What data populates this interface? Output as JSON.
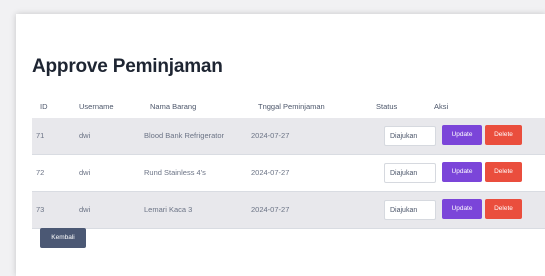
{
  "page": {
    "title": "Approve Peminjaman"
  },
  "table": {
    "headers": {
      "id": "ID",
      "username": "Username",
      "nama_barang": "Nama Barang",
      "tanggal": "Tnggal Peminjaman",
      "status": "Status",
      "aksi": "Aksi"
    },
    "rows": [
      {
        "id": "71",
        "username": "dwi",
        "nama_barang": "Blood Bank Refrigerator",
        "tanggal": "2024-07-27",
        "status": "Diajukan",
        "update": "Update",
        "delete": "Delete"
      },
      {
        "id": "72",
        "username": "dwi",
        "nama_barang": "Rund Stainless 4's",
        "tanggal": "2024-07-27",
        "status": "Diajukan",
        "update": "Update",
        "delete": "Delete"
      },
      {
        "id": "73",
        "username": "dwi",
        "nama_barang": "Lemari Kaca 3",
        "tanggal": "2024-07-27",
        "status": "Diajukan",
        "update": "Update",
        "delete": "Delete"
      }
    ]
  },
  "actions": {
    "back_label": "Kembali"
  },
  "colors": {
    "update": "#7b45d9",
    "delete": "#ea4e3d",
    "back": "#4b5874"
  }
}
